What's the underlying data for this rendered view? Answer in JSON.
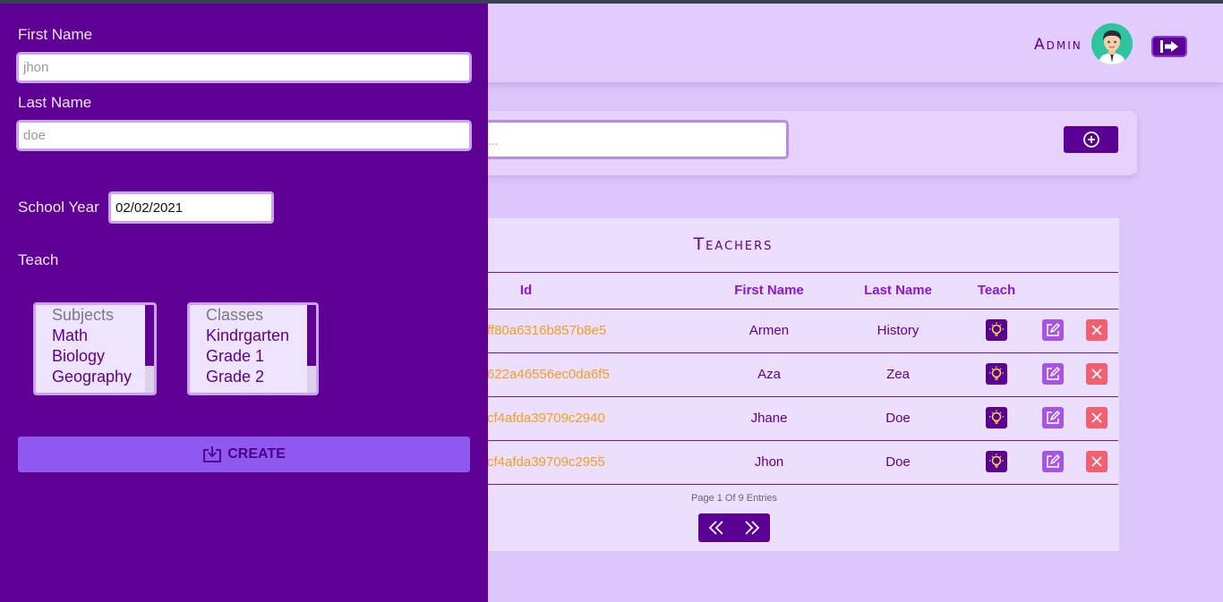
{
  "header": {
    "admin_label": "Admin",
    "avatar_icon": "user-avatar-icon",
    "logout_icon": "logout-icon"
  },
  "search": {
    "placeholder": "...",
    "add_icon": "plus-circle-icon"
  },
  "teachers_table": {
    "title": "Teachers",
    "columns": [
      "Id",
      "First Name",
      "Last Name",
      "Teach"
    ],
    "rows": [
      {
        "id": "ff80a6316b857b8e5",
        "first_name": "Armen",
        "last_name": "History"
      },
      {
        "id": "622a46556ec0da6f5",
        "first_name": "Aza",
        "last_name": "Zea"
      },
      {
        "id": "cf4afda39709c2940",
        "first_name": "Jhane",
        "last_name": "Doe"
      },
      {
        "id": "cf4afda39709c2955",
        "first_name": "Jhon",
        "last_name": "Doe"
      }
    ],
    "row_action_icons": [
      "lightbulb-icon",
      "edit-icon",
      "close-icon"
    ],
    "page_info": "Page 1 Of 9 Entries",
    "pager_icons": [
      "double-chevron-left-icon",
      "double-chevron-right-icon"
    ]
  },
  "form": {
    "first_name_label": "First Name",
    "first_name_placeholder": "jhon",
    "last_name_label": "Last Name",
    "last_name_placeholder": "doe",
    "school_year_label": "School Year",
    "school_year_value": "02/02/2021",
    "teach_label": "Teach",
    "subjects": [
      "Subjects",
      "Math",
      "Biology",
      "Geography"
    ],
    "classes": [
      "Classes",
      "Kindrgarten",
      "Grade 1",
      "Grade 2"
    ],
    "create_label": "CREATE",
    "create_icon": "download-box-icon"
  },
  "colors": {
    "primary": "#5f0094",
    "accent": "#8f59f0",
    "id_text": "#f0a020",
    "delete": "#f25f6f"
  }
}
